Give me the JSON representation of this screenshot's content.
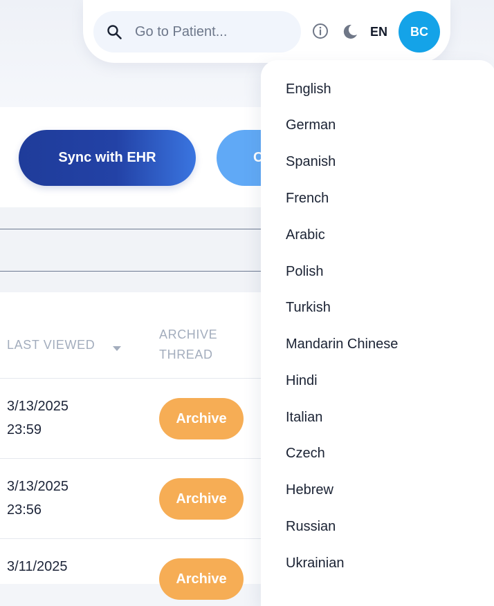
{
  "search": {
    "placeholder": "Go to Patient...",
    "value": ""
  },
  "header": {
    "language_code": "EN",
    "avatar_initials": "BC"
  },
  "actions": {
    "sync_label": "Sync with EHR",
    "second_label_visible": "C"
  },
  "table": {
    "columns": [
      {
        "label_line1": "LAST VIEWED",
        "label_line2": ""
      },
      {
        "label_line1": "ARCHIVE",
        "label_line2": "THREAD"
      }
    ],
    "rows": [
      {
        "date": "3/13/2025",
        "time": "23:59",
        "action": "Archive"
      },
      {
        "date": "3/13/2025",
        "time": "23:56",
        "action": "Archive"
      },
      {
        "date": "3/11/2025",
        "time": "",
        "action": "Archive"
      }
    ]
  },
  "language_menu": {
    "items": [
      "English",
      "German",
      "Spanish",
      "French",
      "Arabic",
      "Polish",
      "Turkish",
      "Mandarin Chinese",
      "Hindi",
      "Italian",
      "Czech",
      "Hebrew",
      "Russian",
      "Ukrainian"
    ]
  },
  "colors": {
    "primary": "#2342a6",
    "secondary": "#60a9f6",
    "archive": "#f6ad55",
    "avatar": "#14a3e8"
  }
}
